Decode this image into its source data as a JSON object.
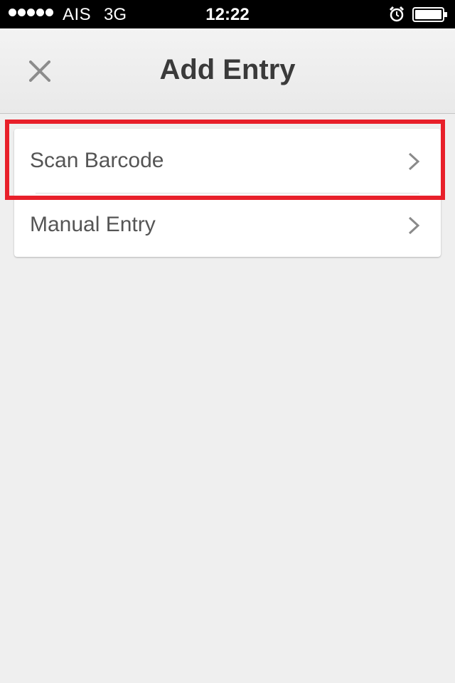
{
  "status_bar": {
    "carrier": "AIS",
    "network": "3G",
    "time": "12:22"
  },
  "nav": {
    "title": "Add Entry",
    "close_icon": "close-icon"
  },
  "menu": {
    "items": [
      {
        "label": "Scan Barcode",
        "icon": "chevron-right-icon"
      },
      {
        "label": "Manual Entry",
        "icon": "chevron-right-icon"
      }
    ]
  },
  "colors": {
    "background": "#efefef",
    "title": "#3a3a3a",
    "label": "#555555",
    "highlight": "#e8202a"
  }
}
